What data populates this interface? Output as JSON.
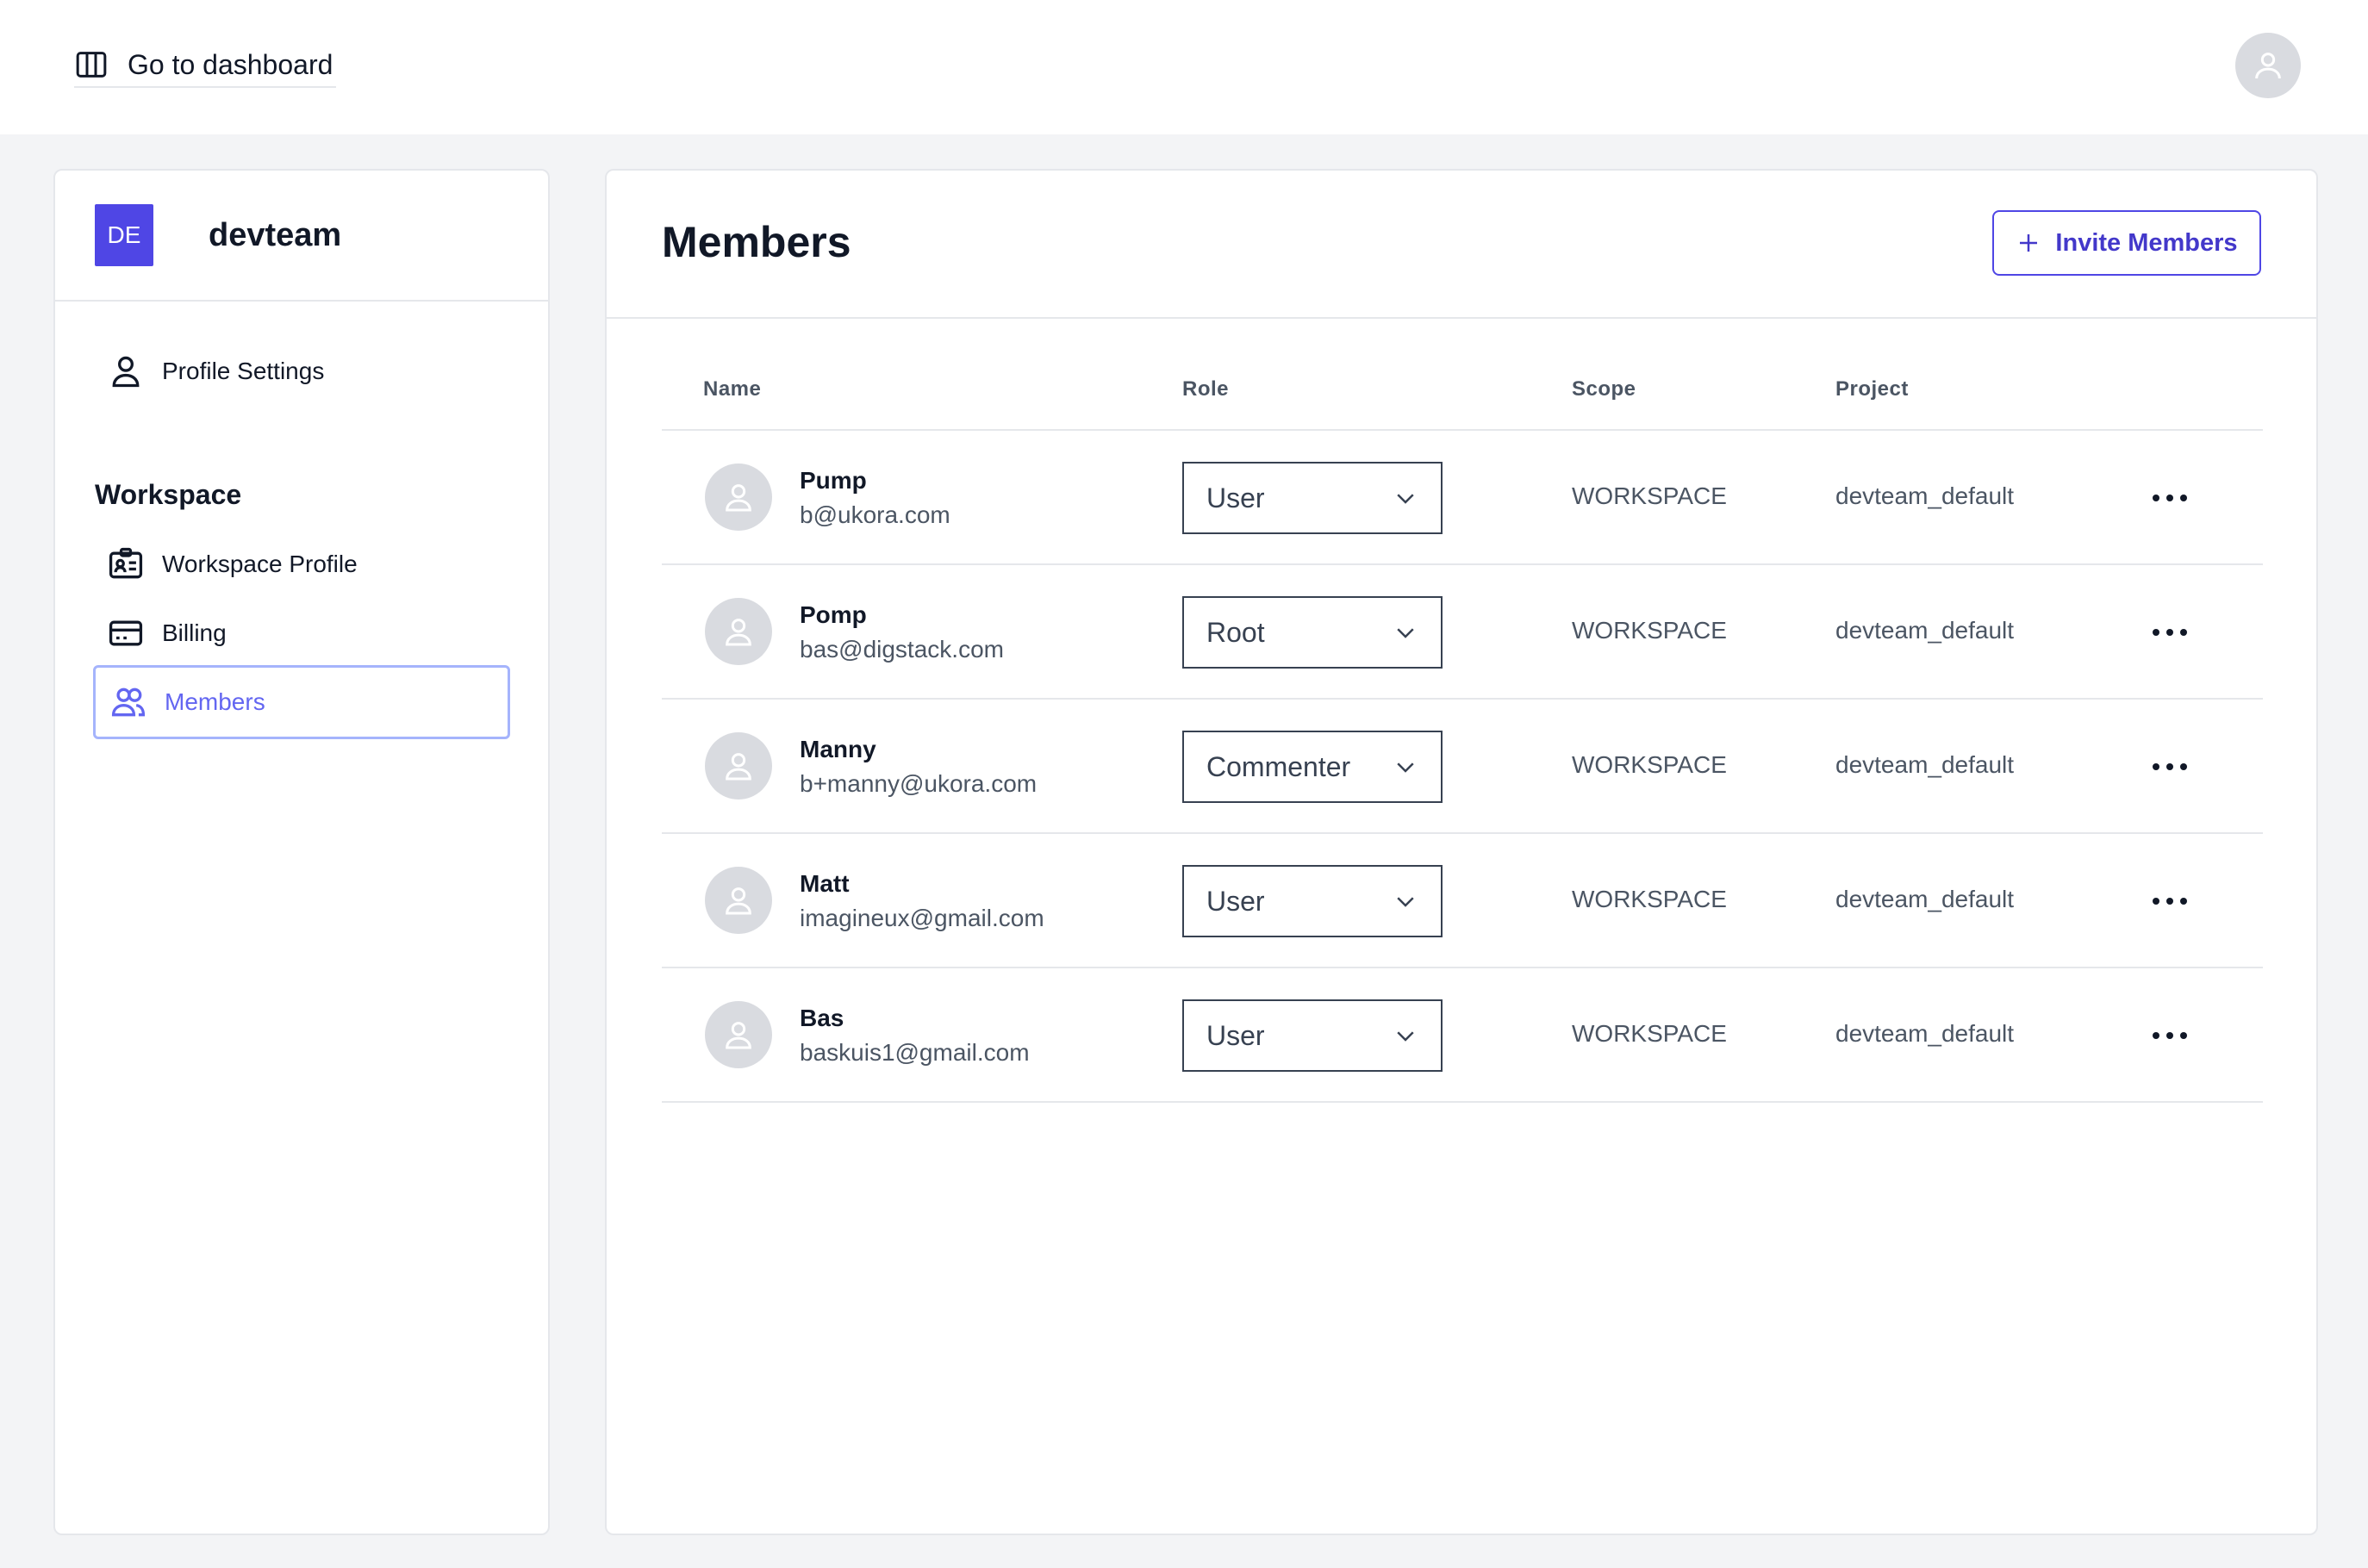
{
  "topbar": {
    "dashboard_link": "Go to dashboard",
    "dashboard_icon": "columns-icon",
    "avatar_icon": "user-icon"
  },
  "sidebar": {
    "workspace_badge": "DE",
    "workspace_name": "devteam",
    "profile_settings": "Profile Settings",
    "section_title": "Workspace",
    "items": [
      {
        "label": "Workspace Profile",
        "icon": "id-card-icon"
      },
      {
        "label": "Billing",
        "icon": "credit-card-icon"
      },
      {
        "label": "Members",
        "icon": "users-icon",
        "active": true
      }
    ]
  },
  "main": {
    "title": "Members",
    "invite_button": "Invite Members",
    "columns": {
      "name": "Name",
      "role": "Role",
      "scope": "Scope",
      "project": "Project"
    },
    "members": [
      {
        "name": "Pump",
        "email": "b@ukora.com",
        "role": "User",
        "scope": "WORKSPACE",
        "project": "devteam_default"
      },
      {
        "name": "Pomp",
        "email": "bas@digstack.com",
        "role": "Root",
        "scope": "WORKSPACE",
        "project": "devteam_default"
      },
      {
        "name": "Manny",
        "email": "b+manny@ukora.com",
        "role": "Commenter",
        "scope": "WORKSPACE",
        "project": "devteam_default"
      },
      {
        "name": "Matt",
        "email": "imagineux@gmail.com",
        "role": "User",
        "scope": "WORKSPACE",
        "project": "devteam_default"
      },
      {
        "name": "Bas",
        "email": "baskuis1@gmail.com",
        "role": "User",
        "scope": "WORKSPACE",
        "project": "devteam_default"
      }
    ]
  },
  "colors": {
    "accent": "#4f46e5",
    "active_nav": "#6366f1",
    "border": "#e5e7eb",
    "background": "#f3f4f6"
  }
}
